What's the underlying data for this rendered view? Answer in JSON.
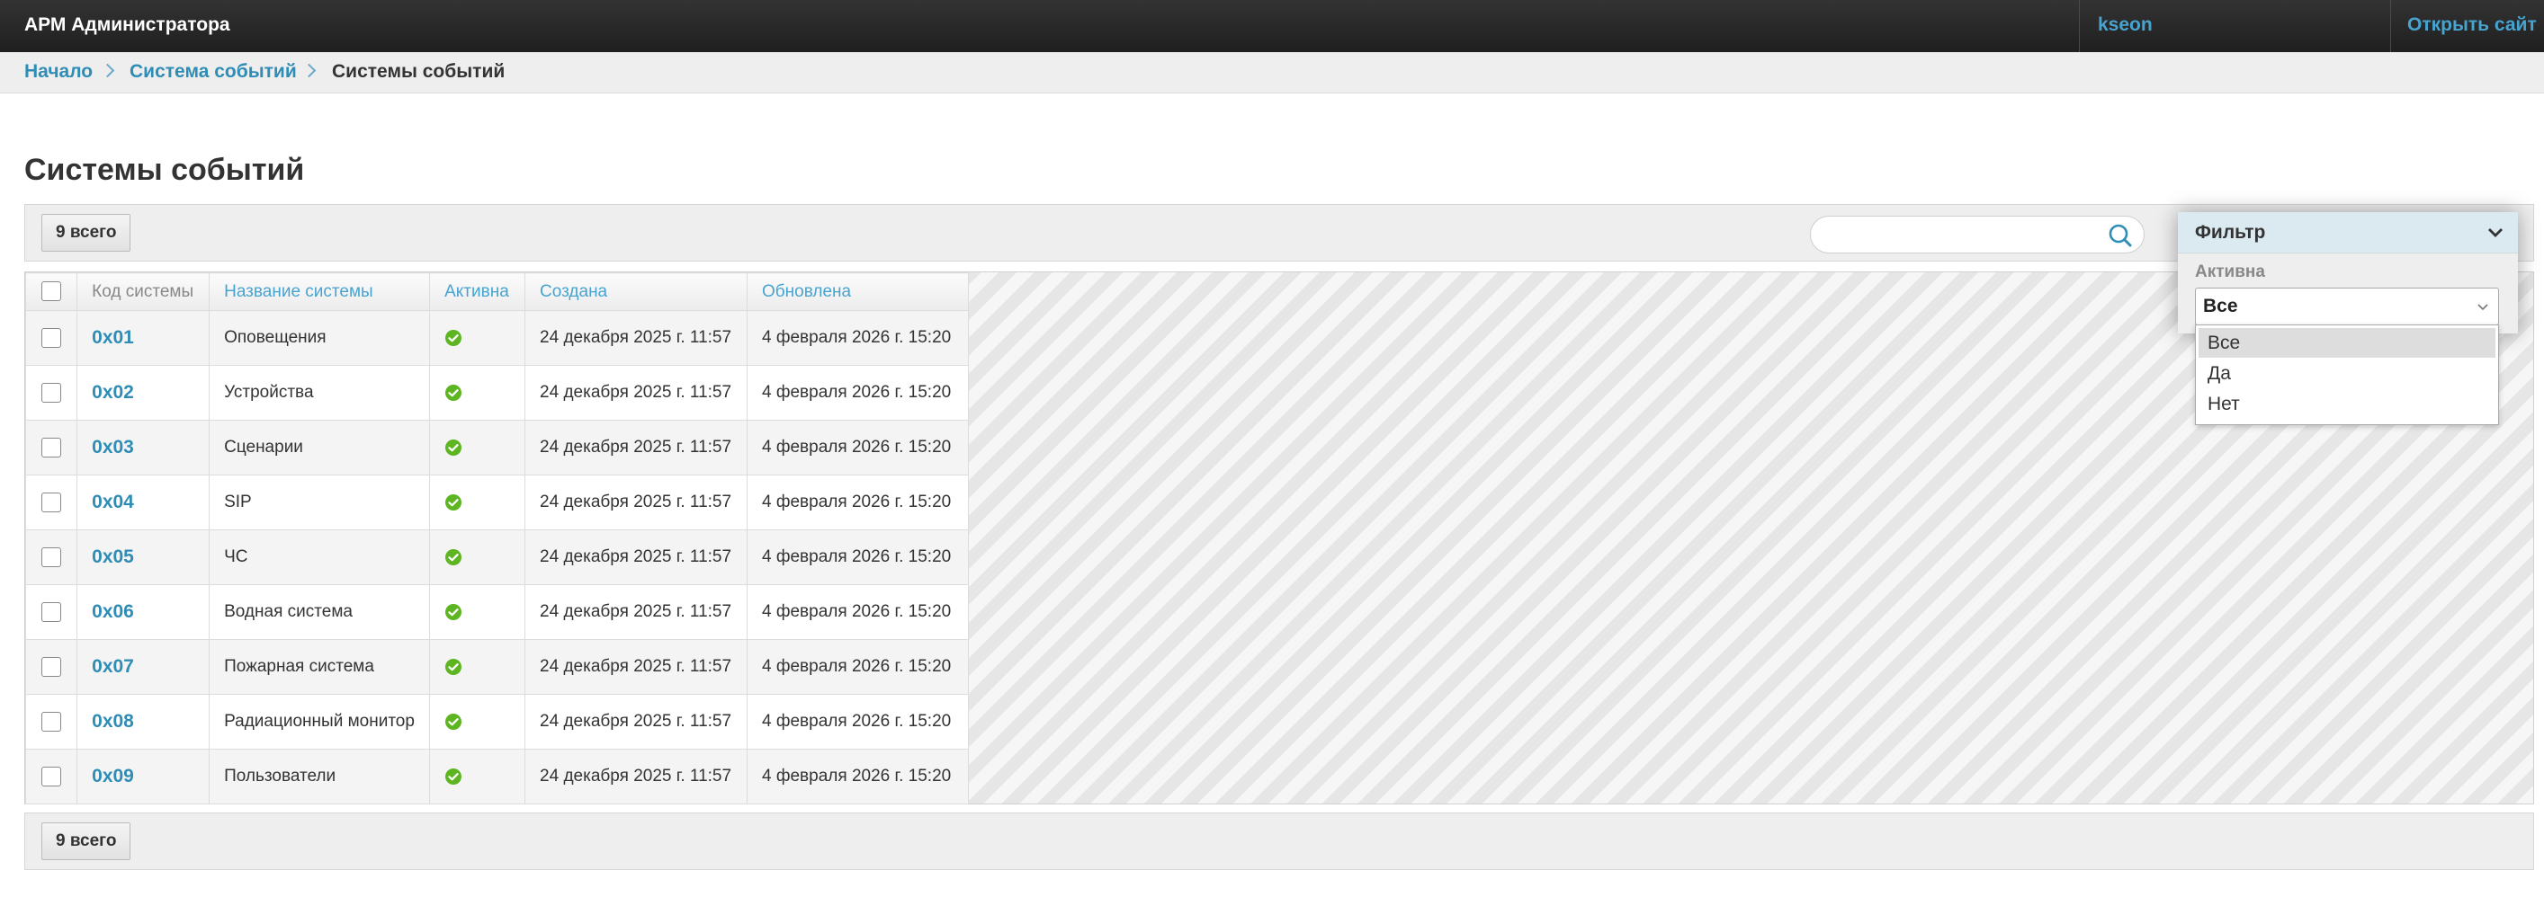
{
  "header": {
    "title": "АРМ Администратора",
    "user": "kseon",
    "open_site": "Открыть сайт"
  },
  "breadcrumbs": [
    "Начало",
    "Система событий",
    "Системы событий"
  ],
  "page": {
    "title": "Системы событий"
  },
  "toolbar": {
    "count_label": "9 всего",
    "search_placeholder": ""
  },
  "table": {
    "columns": [
      "Код системы",
      "Название системы",
      "Активна",
      "Создана",
      "Обновлена"
    ],
    "rows": [
      {
        "code": "0x01",
        "name": "Оповещения",
        "active": true,
        "created": "24 декабря 2025 г. 11:57",
        "updated": "4 февраля 2026 г. 15:20"
      },
      {
        "code": "0x02",
        "name": "Устройства",
        "active": true,
        "created": "24 декабря 2025 г. 11:57",
        "updated": "4 февраля 2026 г. 15:20"
      },
      {
        "code": "0x03",
        "name": "Сценарии",
        "active": true,
        "created": "24 декабря 2025 г. 11:57",
        "updated": "4 февраля 2026 г. 15:20"
      },
      {
        "code": "0x04",
        "name": "SIP",
        "active": true,
        "created": "24 декабря 2025 г. 11:57",
        "updated": "4 февраля 2026 г. 15:20"
      },
      {
        "code": "0x05",
        "name": "ЧС",
        "active": true,
        "created": "24 декабря 2025 г. 11:57",
        "updated": "4 февраля 2026 г. 15:20"
      },
      {
        "code": "0x06",
        "name": "Водная система",
        "active": true,
        "created": "24 декабря 2025 г. 11:57",
        "updated": "4 февраля 2026 г. 15:20"
      },
      {
        "code": "0x07",
        "name": "Пожарная система",
        "active": true,
        "created": "24 декабря 2025 г. 11:57",
        "updated": "4 февраля 2026 г. 15:20"
      },
      {
        "code": "0x08",
        "name": "Радиационный монитор",
        "active": true,
        "created": "24 декабря 2025 г. 11:57",
        "updated": "4 февраля 2026 г. 15:20"
      },
      {
        "code": "0x09",
        "name": "Пользователи",
        "active": true,
        "created": "24 декабря 2025 г. 11:57",
        "updated": "4 февраля 2026 г. 15:20"
      }
    ]
  },
  "filter": {
    "title": "Фильтр",
    "field_label": "Активна",
    "selected": "Все",
    "options": [
      "Все",
      "Да",
      "Нет"
    ]
  },
  "colors": {
    "header_bg": "#2b2b2b",
    "link": "#2f8db5",
    "header_link": "#47a4d1",
    "active_icon": "#5cb521",
    "filter_head_bg": "#dbe9f0"
  },
  "icons": {
    "search": "search-icon",
    "active": "check-circle-icon",
    "filter_toggle": "chevron-down-icon",
    "select_arrow": "chevron-down-icon"
  }
}
